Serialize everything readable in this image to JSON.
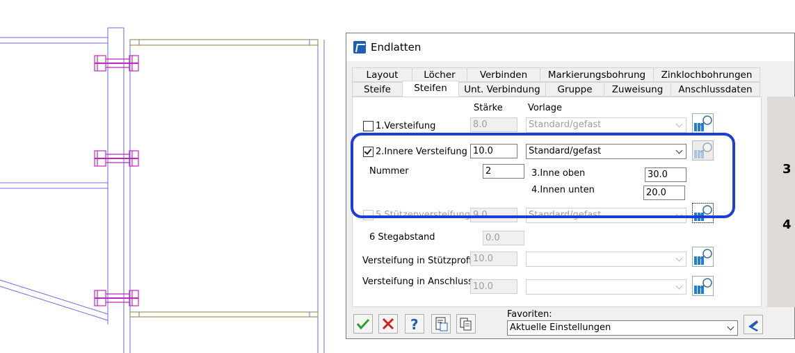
{
  "dialog": {
    "title": "Endlatten",
    "tabs_row1": [
      "Layout",
      "Löcher",
      "Verbinden",
      "Markierungsbohrung",
      "Zinklochbohrungen"
    ],
    "tabs_row2": [
      "Steife",
      "Steifen",
      "Unt. Verbindung",
      "Gruppe",
      "Zuweisung",
      "Anschlussdaten"
    ],
    "active_tab": "Steifen",
    "column_headers": {
      "thickness": "Stärke",
      "template": "Vorlage"
    },
    "stiffener1": {
      "label": "1.Versteifung",
      "checked": false,
      "thickness": "8.0",
      "template": "Standard/gefast"
    },
    "stiffener2": {
      "label": "2.Innere Versteifung",
      "checked": true,
      "thickness": "10.0",
      "template": "Standard/gefast",
      "nummer_label": "Nummer",
      "nummer": "2",
      "top_label": "3.Inne oben",
      "top_value": "30.0",
      "bottom_label": "4.Innen unten",
      "bottom_value": "20.0"
    },
    "stiffener5": {
      "label": "5.Stützenversteifung",
      "checked": false,
      "thickness": "9.0",
      "template": "Standard/gefast"
    },
    "web_distance": {
      "label": "6 Stegabstand",
      "value": "0.0"
    },
    "column_profile": {
      "label": "Versteifung in Stützprofil",
      "value": "10.0",
      "template": ""
    },
    "connection": {
      "label": "Versteifung in Anschluss",
      "value": "10.0",
      "template": ""
    },
    "favorites": {
      "label": "Favoriten:",
      "selected": "Aktuelle Einstellungen"
    },
    "right_panel_numbers": [
      "3",
      "4"
    ],
    "bottom_buttons": [
      "ok-icon",
      "cancel-icon",
      "help-icon",
      "load-icon",
      "copy-icon"
    ]
  },
  "colors": {
    "highlight": "#1c3ed6",
    "cad_lines": "#5e5ee0",
    "bolts": "#c025c0",
    "accent": "#1d5fb4"
  }
}
